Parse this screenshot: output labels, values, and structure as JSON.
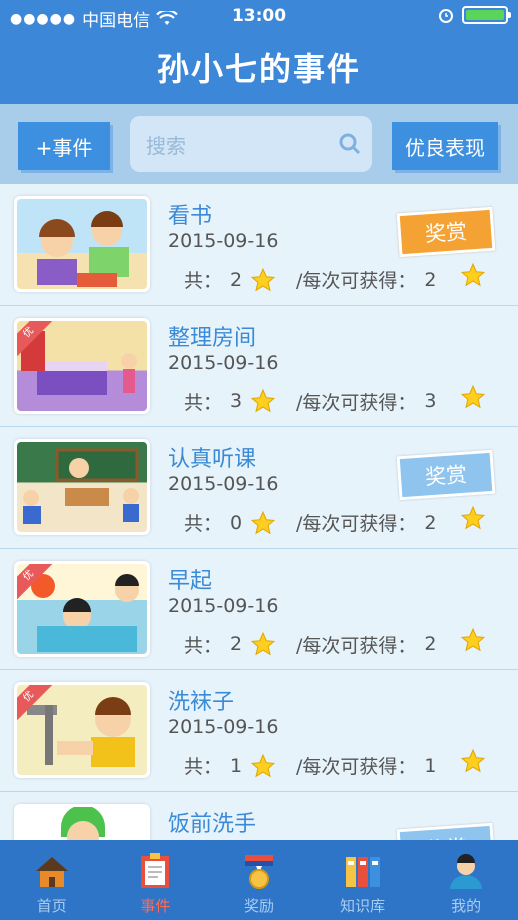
{
  "status": {
    "carrier": "中国电信",
    "time": "13:00"
  },
  "header": {
    "title": "孙小七的事件"
  },
  "toolbar": {
    "add_label": "+事件",
    "search_placeholder": "搜索",
    "good_label": "优良表现"
  },
  "labels": {
    "total_prefix": "共：",
    "per_prefix": "/每次可获得：",
    "badge_good": "优"
  },
  "events": [
    {
      "name": "看书",
      "date": "2015-09-16",
      "total": "2",
      "per": "2",
      "reward": "奖赏",
      "reward_color": "#f5a235",
      "badge": false
    },
    {
      "name": "整理房间",
      "date": "2015-09-16",
      "total": "3",
      "per": "3",
      "reward": "",
      "badge": true
    },
    {
      "name": "认真听课",
      "date": "2015-09-16",
      "total": "0",
      "per": "2",
      "reward": "奖赏",
      "reward_color": "#8ec4ee",
      "badge": false
    },
    {
      "name": "早起",
      "date": "2015-09-16",
      "total": "2",
      "per": "2",
      "reward": "",
      "badge": true
    },
    {
      "name": "洗袜子",
      "date": "2015-09-16",
      "total": "1",
      "per": "1",
      "reward": "",
      "badge": true
    },
    {
      "name": "饭前洗手",
      "date": "",
      "total": "",
      "per": "",
      "reward": "奖赏",
      "reward_color": "#8ec4ee",
      "badge": false
    }
  ],
  "tabs": [
    {
      "label": "首页",
      "icon": "home-icon",
      "active": false
    },
    {
      "label": "事件",
      "icon": "clipboard-icon",
      "active": true
    },
    {
      "label": "奖励",
      "icon": "medal-icon",
      "active": false
    },
    {
      "label": "知识库",
      "icon": "books-icon",
      "active": false
    },
    {
      "label": "我的",
      "icon": "user-icon",
      "active": false
    }
  ],
  "colors": {
    "header": "#3d87d9",
    "accent": "#3a8ad6",
    "active_tab": "#ff6b55",
    "tabbar": "#2e74c7"
  }
}
